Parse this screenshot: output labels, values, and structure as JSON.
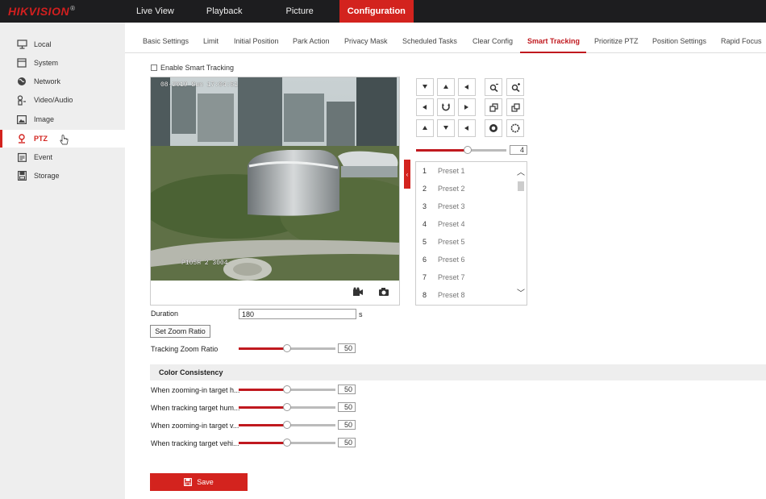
{
  "brand": {
    "name": "HIKVISION",
    "reg": "®",
    "accent": "#d3231e"
  },
  "topnav": [
    "Live View",
    "Playback",
    "Picture",
    "Configuration"
  ],
  "sidebar": [
    {
      "label": "Local",
      "icon": "monitor-icon"
    },
    {
      "label": "System",
      "icon": "system-icon"
    },
    {
      "label": "Network",
      "icon": "globe-icon"
    },
    {
      "label": "Video/Audio",
      "icon": "video-audio-icon"
    },
    {
      "label": "Image",
      "icon": "image-icon"
    },
    {
      "label": "PTZ",
      "icon": "ptz-icon"
    },
    {
      "label": "Event",
      "icon": "event-icon"
    },
    {
      "label": "Storage",
      "icon": "storage-icon"
    }
  ],
  "subtabs": [
    "Basic Settings",
    "Limit",
    "Initial Position",
    "Park Action",
    "Privacy Mask",
    "Scheduled Tasks",
    "Clear Config",
    "Smart Tracking",
    "Prioritize PTZ",
    "Position Settings",
    "Rapid Focus"
  ],
  "enable_label": "Enable Smart Tracking",
  "video": {
    "osd_time": "08-2019 Sun 17:04:51",
    "osd_label": "P105H 2 3004"
  },
  "ptz": {
    "speed": 4,
    "speed_max": 7,
    "presets": [
      {
        "num": "1",
        "name": "Preset 1"
      },
      {
        "num": "2",
        "name": "Preset 2"
      },
      {
        "num": "3",
        "name": "Preset 3"
      },
      {
        "num": "4",
        "name": "Preset 4"
      },
      {
        "num": "5",
        "name": "Preset 5"
      },
      {
        "num": "6",
        "name": "Preset 6"
      },
      {
        "num": "7",
        "name": "Preset 7"
      },
      {
        "num": "8",
        "name": "Preset 8"
      }
    ]
  },
  "form": {
    "duration_label": "Duration",
    "duration_value": "180",
    "duration_unit": "s",
    "set_zoom_label": "Set Zoom Ratio",
    "tracking_zoom_label": "Tracking Zoom Ratio",
    "tracking_zoom_value": "50",
    "slider_fraction": 0.5
  },
  "color_consistency": {
    "title": "Color Consistency",
    "rows": [
      {
        "label": "When zooming-in target h...",
        "value": "50"
      },
      {
        "label": "When tracking target hum...",
        "value": "50"
      },
      {
        "label": "When zooming-in target v...",
        "value": "50"
      },
      {
        "label": "When tracking target vehi...",
        "value": "50"
      }
    ]
  },
  "save_label": "Save"
}
